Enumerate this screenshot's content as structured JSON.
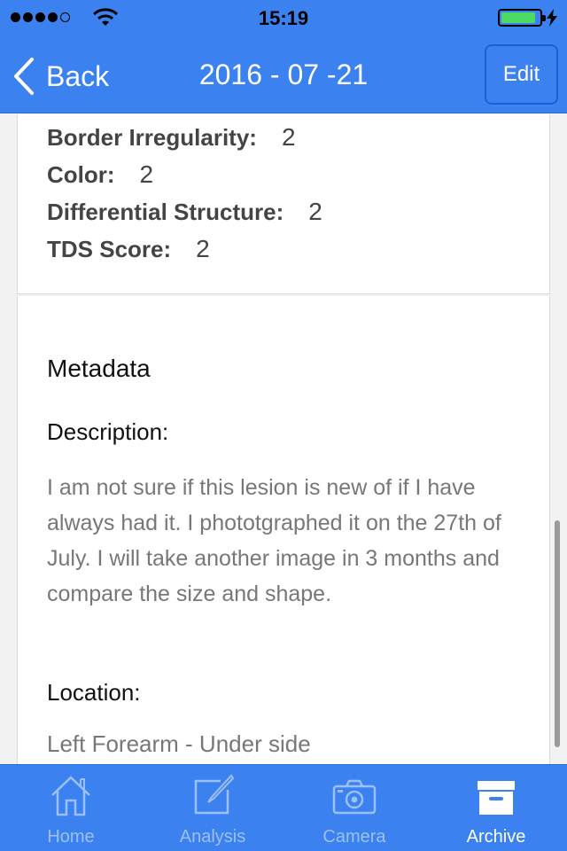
{
  "status": {
    "time": "15:19",
    "signal_bars": 4,
    "battery_level": 0.9
  },
  "nav": {
    "back_label": "Back",
    "title": "2016 - 07 -21",
    "edit_label": "Edit"
  },
  "scores": [
    {
      "label": "Border Irregularity:",
      "value": "2"
    },
    {
      "label": "Color:",
      "value": "2"
    },
    {
      "label": "Differential Structure:",
      "value": "2"
    },
    {
      "label": "TDS Score:",
      "value": "2"
    }
  ],
  "metadata": {
    "title": "Metadata",
    "description_label": "Description:",
    "description": "I am not sure if this lesion is new of if I have always had it. I phototgraphed it on the 27th of July. I will take another image in 3 months and compare the size and shape.",
    "location_label": "Location:",
    "location": "Left Forearm - Under side"
  },
  "tabs": [
    {
      "label": "Home",
      "icon": "home-icon",
      "active": false
    },
    {
      "label": "Analysis",
      "icon": "edit-icon",
      "active": false
    },
    {
      "label": "Camera",
      "icon": "camera-icon",
      "active": false
    },
    {
      "label": "Archive",
      "icon": "archive-icon",
      "active": true
    }
  ],
  "colors": {
    "accent": "#3b82f0",
    "battery": "#4cd964"
  }
}
